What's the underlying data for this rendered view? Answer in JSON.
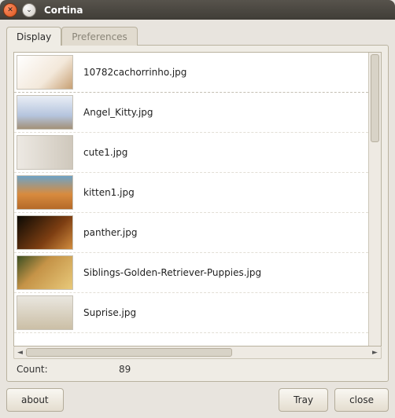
{
  "window": {
    "title": "Cortina"
  },
  "tabs": {
    "display": "Display",
    "preferences": "Preferences",
    "active": "display"
  },
  "files": [
    {
      "thumbClass": "t0",
      "name": "10782cachorrinho.jpg"
    },
    {
      "thumbClass": "t1",
      "name": "Angel_Kitty.jpg"
    },
    {
      "thumbClass": "t2",
      "name": "cute1.jpg"
    },
    {
      "thumbClass": "t3",
      "name": "kitten1.jpg"
    },
    {
      "thumbClass": "t4",
      "name": "panther.jpg"
    },
    {
      "thumbClass": "t5",
      "name": "Siblings-Golden-Retriever-Puppies.jpg"
    },
    {
      "thumbClass": "t6",
      "name": "Suprise.jpg"
    }
  ],
  "count": {
    "label": "Count:",
    "value": "89"
  },
  "buttons": {
    "about": "about",
    "tray": "Tray",
    "close": "close"
  }
}
